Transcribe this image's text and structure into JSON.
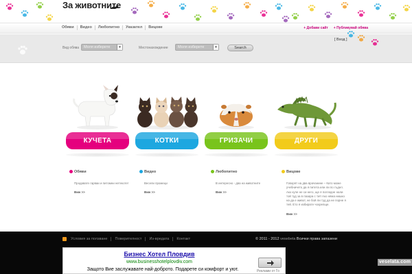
{
  "site": {
    "logo": "За животните"
  },
  "nav": {
    "items": [
      "Обяви",
      "Видео",
      "Любопитно",
      "Указател",
      "Вицове"
    ],
    "right": [
      "+ Добави сайт",
      "+ Публикувай обява"
    ]
  },
  "search": {
    "login": "[ Вход ]",
    "type_label": "Вид обява",
    "type_value": "Моля изберете",
    "place_label": "Местонахождение",
    "place_value": "Моля изберете",
    "button": "Search"
  },
  "categories": [
    {
      "label": "КУЧЕТА",
      "color": "#e5007e"
    },
    {
      "label": "КОТКИ",
      "color": "#1da7e0"
    },
    {
      "label": "ГРИЗАЧИ",
      "color": "#79c41c"
    },
    {
      "label": "ДРУГИ",
      "color": "#f2cb1b"
    }
  ],
  "columns": [
    {
      "title": "Обяви",
      "color": "#e5007e",
      "text": "Продавате гарваи и питомни нетекоте!",
      "more": "Виж >>"
    },
    {
      "title": "Видео",
      "color": "#1da7e0",
      "text": "Весели промеци",
      "more": "Виж >>"
    },
    {
      "title": "Любопитно",
      "color": "#79c41c",
      "text": "В интересно - два на животните",
      "more": "Виж >>"
    },
    {
      "title": "Вицове",
      "color": "#f2cb1b",
      "text": "Говорят на два врачанине – Като може учебничето да я питета или ли по гъдел. Ако куче не си него, ще я погледне нали той туд за в пазара с ти!! Ако няма нишко на да е живот, не бой ли туд да не порне я тей. Ето я избирате чохрепще.",
      "more": "Виж >>"
    }
  ],
  "footer": {
    "links": [
      "Условия за ползване",
      "Поверителност",
      "Из-вредата",
      "Контакт"
    ],
    "copyright": "© 2011 - 2012",
    "brand": "vesebeta",
    "rights": "Всички права запазени"
  },
  "ad": {
    "title": "Бизнес Хотел Пловдив",
    "url": "www.businesshotelplovdiv.com",
    "desc": "Защото Вие заслужавате най-доброто. Подарете си комфорт и уют.",
    "brand": "Реклами от Го"
  },
  "watermark": "veselata.com"
}
